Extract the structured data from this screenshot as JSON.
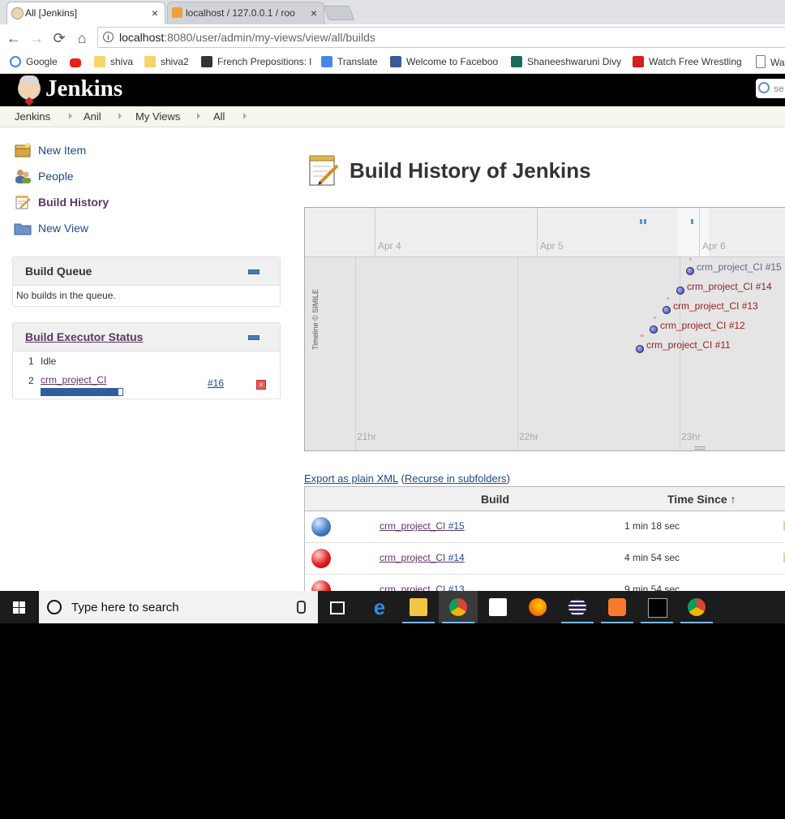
{
  "browser": {
    "tabs": [
      {
        "title": "All [Jenkins]",
        "close": "×"
      },
      {
        "title": "localhost / 127.0.0.1 / roo",
        "close": "×"
      }
    ],
    "url_host": "localhost",
    "url_rest": ":8080/user/admin/my-views/view/all/builds",
    "bookmarks": [
      {
        "label": "Google",
        "icon": "google-icon",
        "color": "#4285f4"
      },
      {
        "label": "",
        "icon": "youtube-icon",
        "color": "#e62117"
      },
      {
        "label": "shiva",
        "icon": "folder-icon",
        "color": "#f6d46b"
      },
      {
        "label": "shiva2",
        "icon": "folder-icon",
        "color": "#f6d46b"
      },
      {
        "label": "French Prepositions: l",
        "icon": "co-icon",
        "color": "#333333"
      },
      {
        "label": "Translate",
        "icon": "translate-icon",
        "color": "#4a86e8"
      },
      {
        "label": "Welcome to Faceboo",
        "icon": "facebook-icon",
        "color": "#3b5998"
      },
      {
        "label": "Shaneeshwaruni Divy",
        "icon": "mm-icon",
        "color": "#1a6b5a"
      },
      {
        "label": "Watch Free Wrestling",
        "icon": "wu-icon",
        "color": "#d21f1f"
      },
      {
        "label": "Wa",
        "icon": "page-icon",
        "color": "#777777"
      }
    ]
  },
  "jenkins": {
    "title": "Jenkins",
    "search_placeholder": "se",
    "breadcrumbs": [
      "Jenkins",
      "Anil",
      "My Views",
      "All"
    ],
    "tasks": [
      {
        "label": "New Item",
        "icon": "new-item-icon"
      },
      {
        "label": "People",
        "icon": "people-icon"
      },
      {
        "label": "Build History",
        "icon": "notepad-icon"
      },
      {
        "label": "New View",
        "icon": "folder-icon"
      }
    ],
    "build_queue": {
      "title": "Build Queue",
      "empty_text": "No builds in the queue."
    },
    "executor_status": {
      "title": "Build Executor Status",
      "executors": [
        {
          "num": "1",
          "state": "Idle"
        },
        {
          "num": "2",
          "job": "crm_project_CI",
          "build": "#16",
          "progress": 0.95
        }
      ]
    },
    "page_title": "Build History of Jenkins",
    "timeline": {
      "date_labels": [
        "Apr 4",
        "Apr 5",
        "Apr 6"
      ],
      "hour_labels": [
        "21hr",
        "22hr",
        "23hr"
      ],
      "credit": "Timeline © SIMILE",
      "events": [
        {
          "label": "crm_project_CI #15",
          "status": "success",
          "color": "#5a6a8a"
        },
        {
          "label": "crm_project_CI #14",
          "status": "failed",
          "color": "#9b1c1c"
        },
        {
          "label": "crm_project_CI #13",
          "status": "failed",
          "color": "#9b1c1c"
        },
        {
          "label": "crm_project_CI #12",
          "status": "failed",
          "color": "#9b1c1c"
        },
        {
          "label": "crm_project_CI #11",
          "status": "failed",
          "color": "#9b1c1c"
        }
      ]
    },
    "export": {
      "link": "Export as plain XML",
      "open": "(",
      "recurse": "Recurse in subfolders",
      "close": ")"
    },
    "history_table": {
      "columns": [
        "Build",
        "Time Since ↑"
      ],
      "rows": [
        {
          "status": "blue",
          "job": "crm_project_CI",
          "build": "#15",
          "since": "1 min 18 sec"
        },
        {
          "status": "red",
          "job": "crm_project_CI",
          "build": "#14",
          "since": "4 min 54 sec"
        },
        {
          "status": "red",
          "job": "crm_project_CI",
          "build": "#13",
          "since": "9 min 54 sec"
        }
      ]
    }
  },
  "taskbar": {
    "search_placeholder": "Type here to search",
    "apps": [
      {
        "name": "task-view-icon",
        "color": "#ffffff"
      },
      {
        "name": "edge-icon",
        "color": "#1e78d6"
      },
      {
        "name": "file-explorer-icon",
        "color": "#f4c542"
      },
      {
        "name": "chrome-icon",
        "color": "#db4437"
      },
      {
        "name": "store-icon",
        "color": "#ffffff"
      },
      {
        "name": "firefox-icon",
        "color": "#ff7b00"
      },
      {
        "name": "eclipse-icon",
        "color": "#4b3a8c"
      },
      {
        "name": "xampp-icon",
        "color": "#f87a2d"
      },
      {
        "name": "terminal-icon",
        "color": "#222222"
      },
      {
        "name": "chrome-icon-2",
        "color": "#db4437"
      }
    ]
  }
}
